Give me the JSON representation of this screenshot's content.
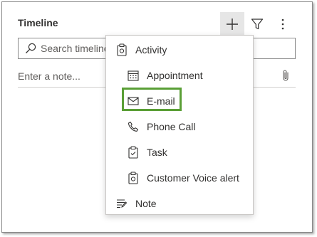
{
  "header": {
    "title": "Timeline"
  },
  "search": {
    "placeholder": "Search timeline"
  },
  "note": {
    "placeholder": "Enter a note..."
  },
  "menu": {
    "items": [
      {
        "label": "Activity",
        "icon": "activity-icon"
      },
      {
        "label": "Appointment",
        "icon": "calendar-icon"
      },
      {
        "label": "E-mail",
        "icon": "envelope-icon"
      },
      {
        "label": "Phone Call",
        "icon": "phone-icon"
      },
      {
        "label": "Task",
        "icon": "clipboard-check-icon"
      },
      {
        "label": "Customer Voice alert",
        "icon": "clipboard-alert-icon"
      },
      {
        "label": "Note",
        "icon": "note-icon"
      }
    ],
    "highlighted_item": "E-mail",
    "highlight_color": "#5a9f36"
  },
  "colors": {
    "add_button_bg": "#e6e6e6",
    "border": "#8a8a8a"
  }
}
